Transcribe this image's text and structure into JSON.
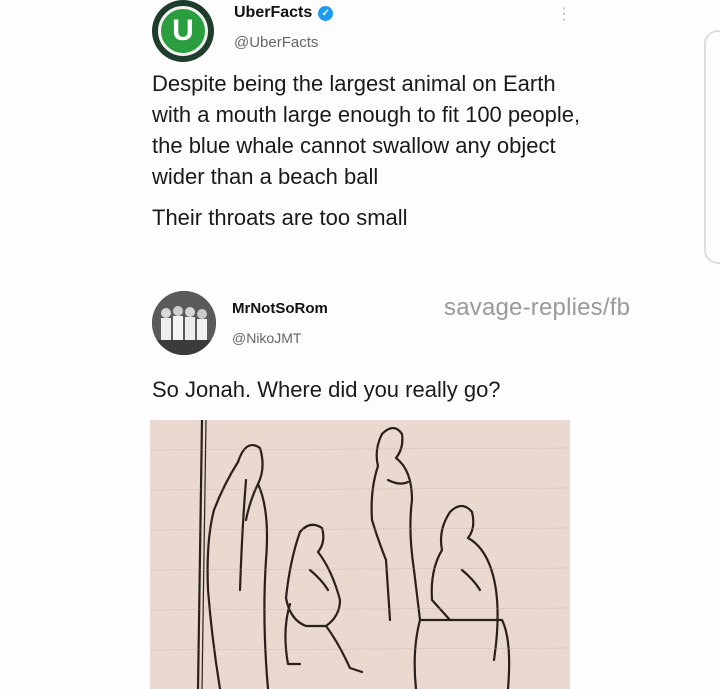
{
  "tweet": {
    "author_name": "UberFacts",
    "author_handle": "@UberFacts",
    "avatar_letter": "U",
    "more_icon": "⋮",
    "paragraphs": [
      "Despite being the largest animal on Earth with a mouth large enough to fit 100 people, the blue whale cannot swallow any object wider than a beach ball",
      "Their throats are too small"
    ]
  },
  "reply": {
    "author_name": "MrNotSoRom",
    "author_handle": "@NikoJMT",
    "text": "So Jonah. Where did you really go?"
  },
  "watermark": "savage-replies/fb",
  "colors": {
    "uberfacts_green": "#2a9d3f",
    "verified_blue": "#1d9bf0",
    "drawing_background": "#e9d9cf"
  }
}
